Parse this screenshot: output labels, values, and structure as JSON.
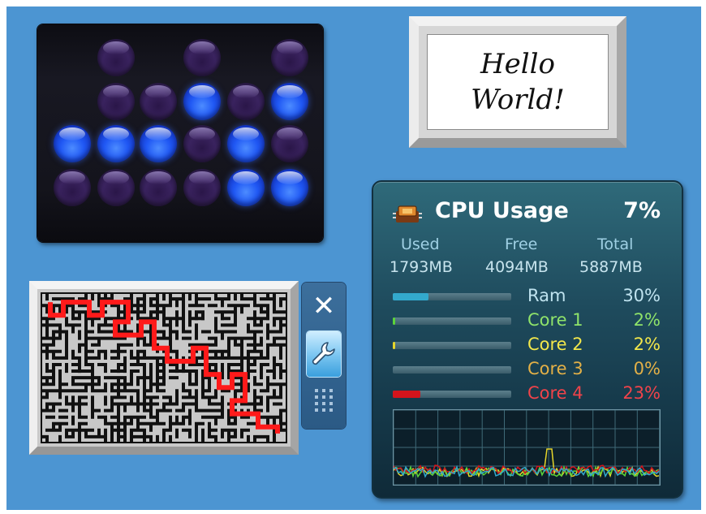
{
  "desktop": {
    "background": "#4c95d2"
  },
  "binary_clock": {
    "colors": {
      "on": "#2058f4",
      "off": "#3a235f"
    },
    "rows": [
      [
        null,
        0,
        null,
        0,
        null,
        0
      ],
      [
        null,
        0,
        0,
        1,
        0,
        1
      ],
      [
        1,
        1,
        1,
        0,
        1,
        0
      ],
      [
        0,
        0,
        0,
        0,
        1,
        1
      ]
    ]
  },
  "note": {
    "line1": "Hello",
    "line2": "World!"
  },
  "maze": {
    "wall_color": "#111111",
    "path_color": "#ff1a1a",
    "floor_color": "#c8c8c8"
  },
  "gadget_controls": {
    "close_icon": "close-icon",
    "options_icon": "wrench-icon",
    "drag_icon": "grip-dots-icon",
    "close_glyph": "✕"
  },
  "cpu": {
    "title": "CPU Usage",
    "total_percent": "7%",
    "memory": {
      "used_label": "Used",
      "free_label": "Free",
      "total_label": "Total",
      "used_value": "1793MB",
      "free_value": "4094MB",
      "total_value": "5887MB"
    },
    "rows": [
      {
        "label": "Ram",
        "value": "30%",
        "fraction": 0.3,
        "color": "#bfe3ef",
        "bar_color": "#33a9cc"
      },
      {
        "label": "Core 1",
        "value": "2%",
        "fraction": 0.02,
        "color": "#8fe36a",
        "bar_color": "#5bd43a"
      },
      {
        "label": "Core 2",
        "value": "2%",
        "fraction": 0.02,
        "color": "#f2e74b",
        "bar_color": "#e6d62a"
      },
      {
        "label": "Core 3",
        "value": "0%",
        "fraction": 0.0,
        "color": "#e3b047",
        "bar_color": "#d99a2a"
      },
      {
        "label": "Core 4",
        "value": "23%",
        "fraction": 0.23,
        "color": "#f0434a",
        "bar_color": "#d4141c"
      }
    ],
    "graph_colors": [
      "#e6d62a",
      "#5bd43a",
      "#d4141c",
      "#33a9cc"
    ]
  }
}
